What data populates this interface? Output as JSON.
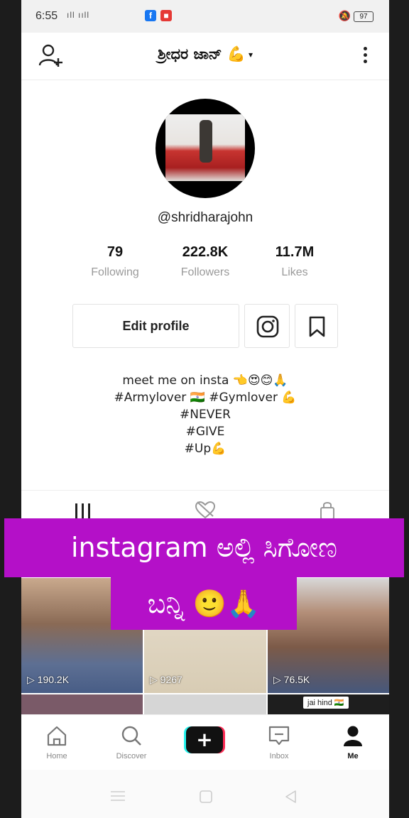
{
  "status_bar": {
    "time": "6:55",
    "signal_text": "ıll ııll",
    "battery": "97",
    "colors": {
      "facebook": "#1877f2",
      "notification": "#e53935"
    }
  },
  "header": {
    "title": "ಶ್ರೀಧರ ಜಾನ್ 💪",
    "caret": "▾"
  },
  "profile": {
    "handle": "@shridharajohn",
    "stats": [
      {
        "value": "79",
        "label": "Following"
      },
      {
        "value": "222.8K",
        "label": "Followers"
      },
      {
        "value": "11.7M",
        "label": "Likes"
      }
    ],
    "edit_button": "Edit profile",
    "bio": [
      "meet me on insta 👈😍😊🙏",
      "#Armylover 🇮🇳 #Gymlover 💪",
      "#NEVER",
      "#GIVE",
      "#Up💪"
    ]
  },
  "videos": [
    {
      "views": "190.2K"
    },
    {
      "views": "9267"
    },
    {
      "views": "76.5K"
    }
  ],
  "video_caption_partial": "jai hind 🇮🇳",
  "overlay_text": {
    "line1": "instagram ಅಲ್ಲಿ ಸಿಗೋಣ",
    "line2": "ಬನ್ನಿ 🙂🙏"
  },
  "bottom_nav": [
    {
      "label": "Home"
    },
    {
      "label": "Discover"
    },
    {
      "label": "Inbox"
    },
    {
      "label": "Me"
    }
  ],
  "plus_symbol": "+",
  "accent_colors": {
    "tiktok_red": "#fe2c55",
    "tiktok_cyan": "#25f4ee",
    "overlay_purple": "#b410c8"
  }
}
